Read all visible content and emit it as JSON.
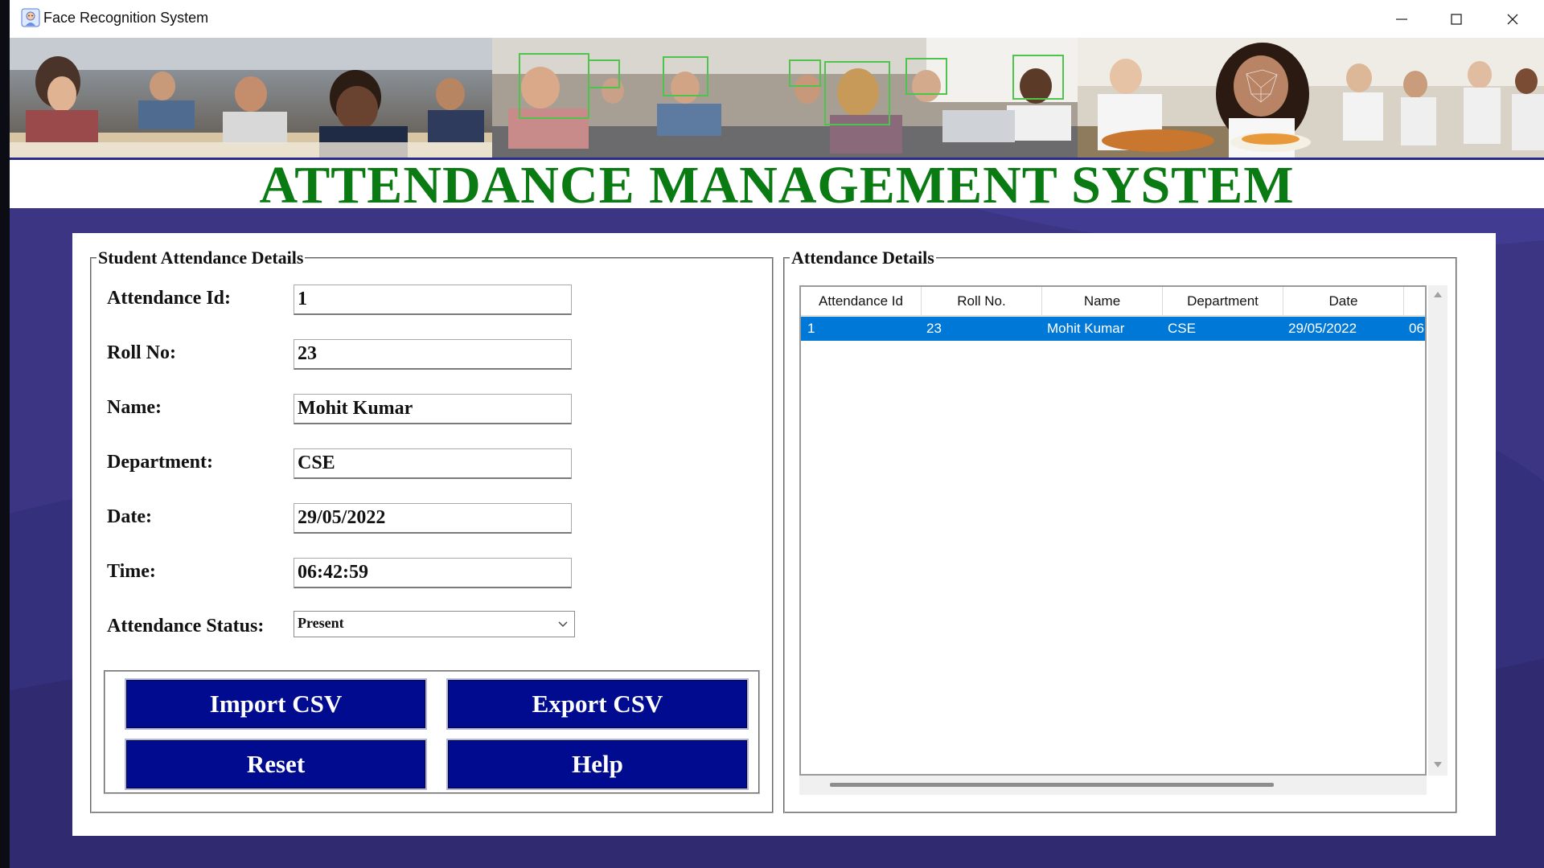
{
  "window": {
    "title": "Face Recognition System"
  },
  "banner": {
    "title": "ATTENDANCE MANAGEMENT SYSTEM",
    "title_color": "#0a7a12"
  },
  "student_frame": {
    "legend": "Student Attendance Details",
    "fields": [
      {
        "label": "Attendance Id:",
        "value": "1"
      },
      {
        "label": "Roll No:",
        "value": "23"
      },
      {
        "label": "Name:",
        "value": "Mohit Kumar"
      },
      {
        "label": "Department:",
        "value": "CSE"
      },
      {
        "label": "Date:",
        "value": "29/05/2022"
      },
      {
        "label": "Time:",
        "value": "06:42:59"
      }
    ],
    "status": {
      "label": "Attendance Status:",
      "value": "Present"
    },
    "buttons": {
      "import": "Import CSV",
      "export": "Export CSV",
      "reset": "Reset",
      "help": "Help"
    },
    "button_color": "#000b8f"
  },
  "attendance_frame": {
    "legend": "Attendance Details",
    "columns": [
      "Attendance Id",
      "Roll No.",
      "Name",
      "Department",
      "Date"
    ],
    "rows": [
      {
        "cells": [
          "1",
          "23",
          "Mohit Kumar",
          "CSE",
          "29/05/2022",
          "06"
        ],
        "selected": true
      }
    ],
    "selection_color": "#0078d7"
  }
}
